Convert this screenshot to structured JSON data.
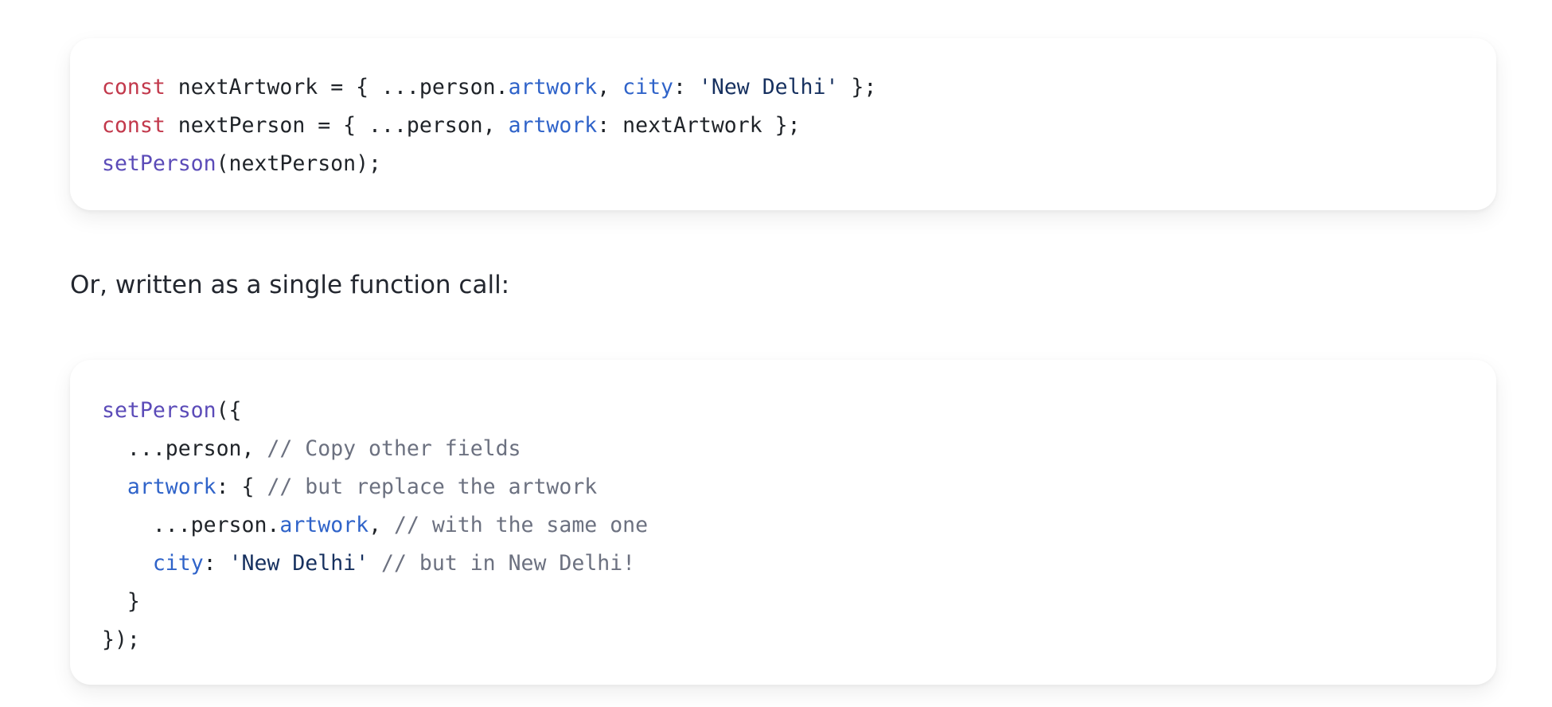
{
  "code_block_1": {
    "lines": [
      [
        {
          "text": "const",
          "token": "keyword"
        },
        {
          "text": " nextArtwork = { ...person.",
          "token": "plain"
        },
        {
          "text": "artwork",
          "token": "property"
        },
        {
          "text": ", ",
          "token": "plain"
        },
        {
          "text": "city",
          "token": "property"
        },
        {
          "text": ": ",
          "token": "plain"
        },
        {
          "text": "'New Delhi'",
          "token": "string"
        },
        {
          "text": " };",
          "token": "plain"
        }
      ],
      [
        {
          "text": "const",
          "token": "keyword"
        },
        {
          "text": " nextPerson = { ...person, ",
          "token": "plain"
        },
        {
          "text": "artwork",
          "token": "property"
        },
        {
          "text": ": nextArtwork };",
          "token": "plain"
        }
      ],
      [
        {
          "text": "setPerson",
          "token": "function"
        },
        {
          "text": "(nextPerson);",
          "token": "plain"
        }
      ]
    ]
  },
  "prose": {
    "text": "Or, written as a single function call:"
  },
  "code_block_2": {
    "lines": [
      [
        {
          "text": "setPerson",
          "token": "function"
        },
        {
          "text": "({",
          "token": "plain"
        }
      ],
      [
        {
          "text": "  ...person, ",
          "token": "plain"
        },
        {
          "text": "// Copy other fields",
          "token": "comment"
        }
      ],
      [
        {
          "text": "  ",
          "token": "plain"
        },
        {
          "text": "artwork",
          "token": "property"
        },
        {
          "text": ": { ",
          "token": "plain"
        },
        {
          "text": "// but replace the artwork",
          "token": "comment"
        }
      ],
      [
        {
          "text": "    ...person.",
          "token": "plain"
        },
        {
          "text": "artwork",
          "token": "property"
        },
        {
          "text": ", ",
          "token": "plain"
        },
        {
          "text": "// with the same one",
          "token": "comment"
        }
      ],
      [
        {
          "text": "    ",
          "token": "plain"
        },
        {
          "text": "city",
          "token": "property"
        },
        {
          "text": ": ",
          "token": "plain"
        },
        {
          "text": "'New Delhi'",
          "token": "string"
        },
        {
          "text": " ",
          "token": "plain"
        },
        {
          "text": "// but in New Delhi!",
          "token": "comment"
        }
      ],
      [
        {
          "text": "  }",
          "token": "plain"
        }
      ],
      [
        {
          "text": "});",
          "token": "plain"
        }
      ]
    ]
  },
  "colors": {
    "keyword": "#c2384b",
    "function": "#5b4bb8",
    "property": "#2f63c9",
    "string": "#16305f",
    "comment": "#6c7180",
    "plain": "#1f2328"
  }
}
